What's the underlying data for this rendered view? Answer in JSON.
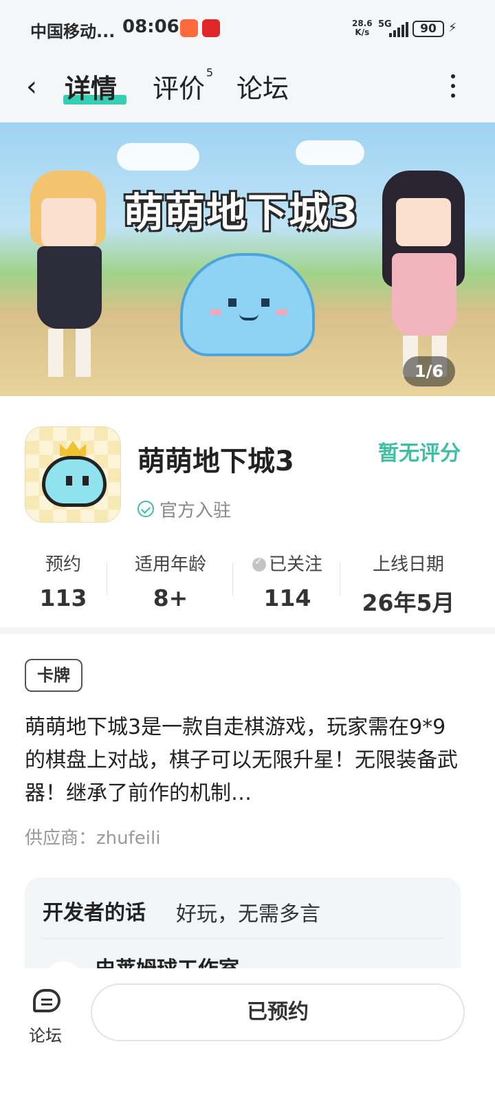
{
  "status_bar": {
    "carrier": "中国移动...",
    "time": "08:06",
    "speed_top": "28.6",
    "speed_bottom": "K/s",
    "network": "5G",
    "battery": "90"
  },
  "header": {
    "back_icon": "chevron-left-icon",
    "tabs": [
      {
        "label": "详情",
        "active": true
      },
      {
        "label": "评价",
        "badge": "5"
      },
      {
        "label": "论坛"
      }
    ],
    "more_icon": "more-vertical-icon"
  },
  "banner": {
    "title": "萌萌地下城3",
    "counter": "1/6"
  },
  "app": {
    "name": "萌萌地下城3",
    "rating": "暂无评分",
    "official_label": "官方入驻",
    "accent_color": "#3dbfa4"
  },
  "stats": [
    {
      "label": "预约",
      "value": "113"
    },
    {
      "label": "适用年龄",
      "value": "8+"
    },
    {
      "label": "已关注",
      "value": "114"
    },
    {
      "label": "上线日期",
      "value": "26年5月"
    }
  ],
  "tag": "卡牌",
  "description": "萌萌地下城3是一款自走棋游戏，玩家需在9*9的棋盘上对战，棋子可以无限升星！无限装备武器！继承了前作的机制…",
  "supplier": "供应商：zhufeili",
  "developer": {
    "title": "开发者的话",
    "message": "好玩，无需多言",
    "studio": "史莱姆球工作室"
  },
  "bottom": {
    "forum_label": "论坛",
    "reserve_button": "已预约"
  }
}
